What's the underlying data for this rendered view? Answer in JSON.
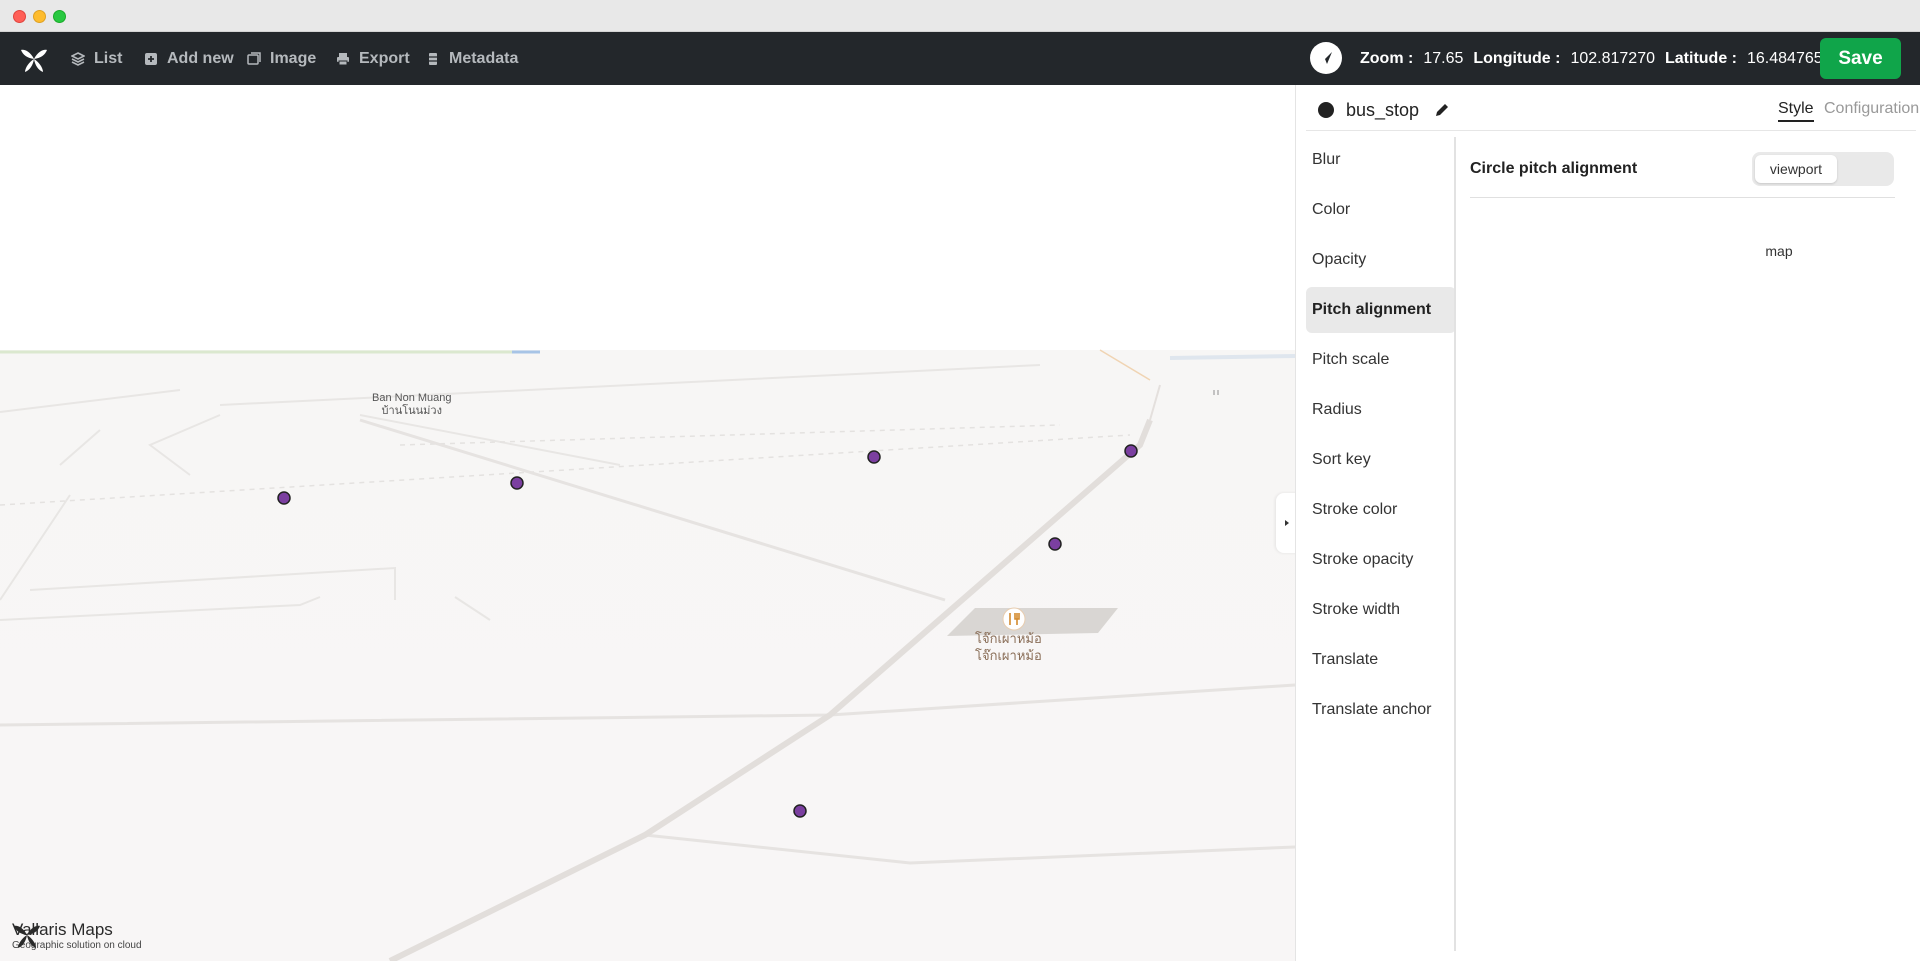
{
  "toolbar": {
    "items": [
      {
        "label": "List",
        "icon": "layers-icon"
      },
      {
        "label": "Add new",
        "icon": "plus-square-icon"
      },
      {
        "label": "Image",
        "icon": "image-icon"
      },
      {
        "label": "Export",
        "icon": "printer-icon"
      },
      {
        "label": "Metadata",
        "icon": "list-icon"
      }
    ],
    "zoom_label": "Zoom :",
    "zoom_value": "17.65",
    "longitude_label": "Longitude :",
    "longitude_value": "102.817270",
    "latitude_label": "Latitude :",
    "latitude_value": "16.484765",
    "save_label": "Save"
  },
  "map": {
    "place_label_en": "Ban Non Muang",
    "place_label_th": "บ้านโนนม่วง",
    "poi_label_1": "โจ๊กเผาหม้อ",
    "poi_label_2": "โจ๊กเผาหม้อ",
    "bus_stop_color": "#7b3fa0",
    "brand_name": "Vallaris Maps",
    "brand_tagline": "Geographic solution on cloud"
  },
  "panel": {
    "layer_name": "bus_stop",
    "tab_style": "Style",
    "tab_config": "Configuration",
    "properties": [
      "Blur",
      "Color",
      "Opacity",
      "Pitch alignment",
      "Pitch scale",
      "Radius",
      "Sort key",
      "Stroke color",
      "Stroke opacity",
      "Stroke width",
      "Translate",
      "Translate anchor"
    ],
    "active_property": "Pitch alignment",
    "property_title": "Circle pitch alignment",
    "options": [
      "map",
      "viewport"
    ],
    "selected_option": "viewport"
  }
}
